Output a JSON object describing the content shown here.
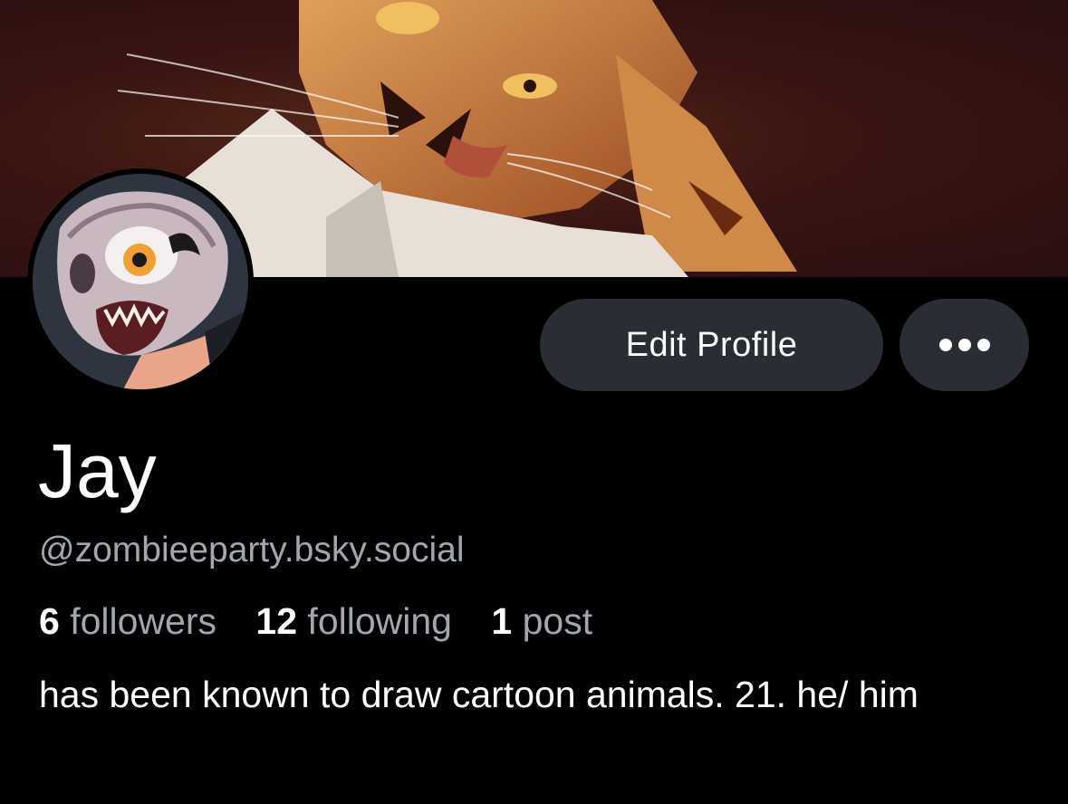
{
  "profile": {
    "display_name": "Jay",
    "handle": "@zombieeparty.bsky.social",
    "bio": "has been known to draw cartoon animals. 21. he/ him",
    "stats": {
      "followers_count": "6",
      "followers_label": "followers",
      "following_count": "12",
      "following_label": "following",
      "posts_count": "1",
      "posts_label": "post"
    }
  },
  "actions": {
    "edit_profile_label": "Edit Profile",
    "more_icon": "ellipsis-icon"
  },
  "colors": {
    "background": "#000000",
    "button_bg": "#2a2d33",
    "secondary_text": "#a2a6ae",
    "primary_text": "#ffffff"
  }
}
